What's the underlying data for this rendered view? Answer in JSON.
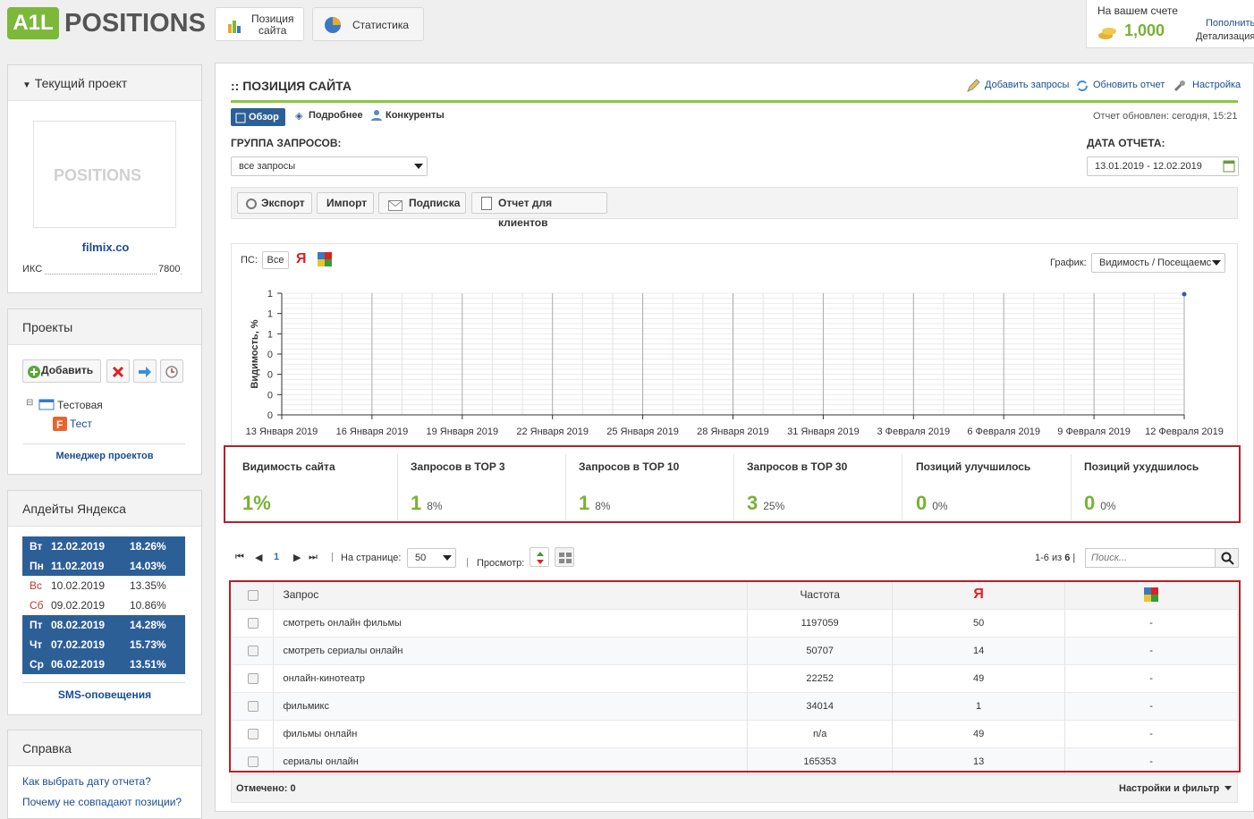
{
  "app": {
    "logo_text": "POSITIONS",
    "logo_badge": "A1L"
  },
  "top_tabs": [
    {
      "label_line1": "Позиция",
      "label_line2": "сайта"
    },
    {
      "label": "Статистика"
    }
  ],
  "account": {
    "title": "На вашем счете",
    "balance": "1,000",
    "topup": "Пополнить",
    "details": "Детализация"
  },
  "current_project": {
    "title": "Текущий проект",
    "logo_text": "POSITIONS",
    "site": "filmix.co",
    "iks_label": "ИКС",
    "iks_value": "7800"
  },
  "projects": {
    "title": "Проекты",
    "add_label": "Добавить",
    "folder": "Тестовая",
    "project": "Тест",
    "manager_link": "Менеджер проектов"
  },
  "yandex_updates": {
    "title": "Апдейты Яндекса",
    "rows": [
      {
        "day": "Вт",
        "date": "12.02.2019",
        "pct": "18.26%",
        "style": "dark"
      },
      {
        "day": "Пн",
        "date": "11.02.2019",
        "pct": "14.03%",
        "style": "dark"
      },
      {
        "day": "Вс",
        "date": "10.02.2019",
        "pct": "13.35%",
        "style": "light"
      },
      {
        "day": "Сб",
        "date": "09.02.2019",
        "pct": "10.86%",
        "style": "light"
      },
      {
        "day": "Пт",
        "date": "08.02.2019",
        "pct": "14.28%",
        "style": "dark"
      },
      {
        "day": "Чт",
        "date": "07.02.2019",
        "pct": "15.73%",
        "style": "dark"
      },
      {
        "day": "Ср",
        "date": "06.02.2019",
        "pct": "13.51%",
        "style": "dark"
      }
    ],
    "sms_link": "SMS-оповещения"
  },
  "help": {
    "title": "Справка",
    "links": [
      "Как выбрать дату отчета?",
      "Почему не совпадают позиции?"
    ]
  },
  "main": {
    "title": ":: ПОЗИЦИЯ САЙТА",
    "actions": [
      "Добавить запросы",
      "Обновить отчет",
      "Настройка"
    ],
    "subtabs": [
      "Обзор",
      "Подробнее",
      "Конкуренты"
    ],
    "report_updated": "Отчет обновлен: сегодня, 15:21",
    "group_label": "ГРУППА ЗАПРОСОВ:",
    "group_value": "все запросы",
    "date_label": "ДАТА ОТЧЕТА:",
    "date_value": "13.01.2019 - 12.02.2019",
    "toolbar": [
      "Экспорт",
      "Импорт",
      "Подписка",
      "Отчет для клиентов"
    ],
    "ps_label": "ПС:",
    "ps_all": "Все",
    "yandex_letter": "Я",
    "graph_label": "График:",
    "graph_value": "Видимость / Посещаемс"
  },
  "chart_data": {
    "type": "line",
    "ylabel": "Видимость, %",
    "y_ticks": [
      "1",
      "1",
      "1",
      "0",
      "0",
      "0",
      "0"
    ],
    "x_ticks": [
      "13 Января 2019",
      "16 Января 2019",
      "19 Января 2019",
      "22 Января 2019",
      "25 Января 2019",
      "28 Января 2019",
      "31 Января 2019",
      "3 Февраля 2019",
      "6 Февраля 2019",
      "9 Февраля 2019",
      "12 Февраля 2019"
    ],
    "series": [
      {
        "points": [
          {
            "x": "12 Февраля 2019",
            "y": 1
          }
        ]
      }
    ],
    "grid": true
  },
  "stats": [
    {
      "label": "Видимость сайта",
      "value": "1%",
      "pct": ""
    },
    {
      "label": "Запросов в TOP 3",
      "value": "1",
      "pct": "8%"
    },
    {
      "label": "Запросов в TOP 10",
      "value": "1",
      "pct": "8%"
    },
    {
      "label": "Запросов в TOP 30",
      "value": "3",
      "pct": "25%"
    },
    {
      "label": "Позиций улучшилось",
      "value": "0",
      "pct": "0%"
    },
    {
      "label": "Позиций ухудшилось",
      "value": "0",
      "pct": "0%"
    }
  ],
  "pager": {
    "page": "1",
    "per_page_label": "На странице:",
    "per_page_value": "50",
    "view_label": "Просмотр:",
    "count_prefix": "1-6 из",
    "count_total": "6",
    "search_placeholder": "Поиск..."
  },
  "table": {
    "headers": {
      "query": "Запрос",
      "freq": "Частота",
      "yandex": "Я"
    },
    "rows": [
      {
        "query": "смотреть онлайн фильмы",
        "freq": "1197059",
        "yandex": "50",
        "google": "-"
      },
      {
        "query": "смотреть сериалы онлайн",
        "freq": "50707",
        "yandex": "14",
        "google": "-"
      },
      {
        "query": "онлайн-кинотеатр",
        "freq": "22252",
        "yandex": "49",
        "google": "-"
      },
      {
        "query": "фильмикс",
        "freq": "34014",
        "yandex": "1",
        "google": "-"
      },
      {
        "query": "фильмы онлайн",
        "freq": "n/a",
        "yandex": "49",
        "google": "-"
      },
      {
        "query": "сериалы онлайн",
        "freq": "165353",
        "yandex": "13",
        "google": "-"
      }
    ]
  },
  "footer": {
    "marked": "Отмечено: 0",
    "settings_link": "Настройки и фильтр"
  },
  "colors": {
    "accent_green": "#77b234",
    "dark_blue": "#2d5f97",
    "highlight_red": "#b3202a",
    "yandex_red": "#e02020"
  }
}
